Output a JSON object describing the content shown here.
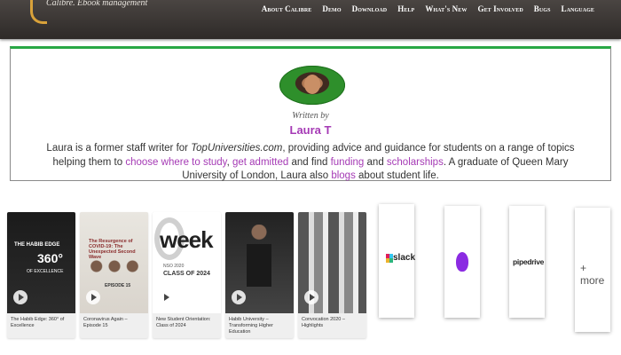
{
  "site": {
    "logo_text": "Calibre. Ebook management"
  },
  "nav": {
    "items": [
      {
        "name": "nav-about",
        "label": "About Calibre"
      },
      {
        "name": "nav-demo",
        "label": "Demo"
      },
      {
        "name": "nav-download",
        "label": "Download"
      },
      {
        "name": "nav-help",
        "label": "Help"
      },
      {
        "name": "nav-whats-new",
        "label": "What's New"
      },
      {
        "name": "nav-get-involved",
        "label": "Get Involved"
      },
      {
        "name": "nav-bugs",
        "label": "Bugs"
      },
      {
        "name": "nav-language",
        "label": "Language"
      }
    ]
  },
  "author": {
    "written_by": "Written by",
    "name": "Laura T",
    "bio": {
      "p1": "Laura is a former staff writer for ",
      "site": "TopUniversities.com",
      "p2": ", providing advice and guidance for students on a range of topics helping them to ",
      "link1": "choose where to study",
      "sep1": ", ",
      "link2": "get admitted",
      "p3": " and find ",
      "link3": "funding",
      "p4": " and ",
      "link4": "scholarships",
      "p5": ". A graduate of Queen Mary University of London, Laura also ",
      "link5": "blogs",
      "p6": " about student life."
    }
  },
  "videos": [
    {
      "caption": "The Habib Edge: 360° of Excellence",
      "overlay_title": "THE HABIB EDGE",
      "overlay_big": "360°",
      "overlay_sub": "OF EXCELLENCE"
    },
    {
      "caption": "Coronavirus Again – Episode 15",
      "overlay_title": "The Resurgence of COVID-19: The Unexpected Second Wave",
      "overlay_ep": "EPISODE 15"
    },
    {
      "caption": "New Student Orientation: Class of 2024",
      "overlay_big": "week",
      "overlay_sub": "NSO 2020",
      "overlay_class": "CLASS OF 2024"
    },
    {
      "caption": "Habib University – Transforming Higher Education"
    },
    {
      "caption": "Convocation 2020 – Highlights"
    }
  ],
  "partners": [
    {
      "name": "slack",
      "label": "slack"
    },
    {
      "name": "purple",
      "label": ""
    },
    {
      "name": "pipedrive",
      "label": "pipedrive"
    },
    {
      "name": "more",
      "label": "+ more"
    }
  ]
}
